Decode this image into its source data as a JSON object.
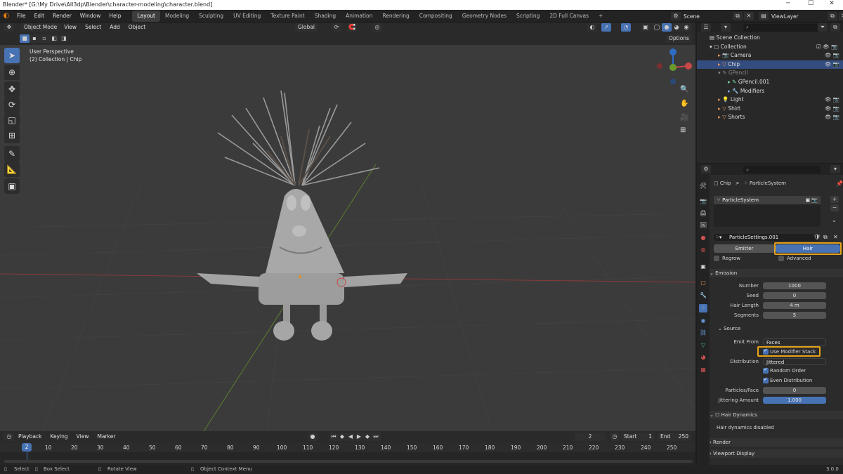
{
  "titlebar": {
    "title": "Blender* [G:\\My Drive\\All3dp\\Blender\\character-modeling\\character.blend]",
    "min": "─",
    "max": "☐",
    "close": "✕"
  },
  "menu": {
    "items": [
      "File",
      "Edit",
      "Render",
      "Window",
      "Help"
    ]
  },
  "workspaces": [
    "Layout",
    "Modeling",
    "Sculpting",
    "UV Editing",
    "Texture Paint",
    "Shading",
    "Animation",
    "Rendering",
    "Compositing",
    "Geometry Nodes",
    "Scripting",
    "2D Full Canvas",
    "+"
  ],
  "scene": {
    "label": "Scene",
    "viewlayer": "ViewLayer"
  },
  "viewport": {
    "mode": "Object Mode",
    "menus": [
      "View",
      "Select",
      "Add",
      "Object"
    ],
    "orientation": "Global",
    "options": "Options",
    "overlay_title": "User Perspective",
    "overlay_sub": "(2) Collection | Chip"
  },
  "outliner": {
    "scene_collection": "Scene Collection",
    "rows": [
      "Collection",
      "Camera",
      "Chip",
      "GPencil",
      "GPencil.001",
      "Modifiers",
      "Light",
      "Shirt",
      "Shorts"
    ]
  },
  "properties": {
    "breadcrumb_obj": "Chip",
    "breadcrumb_sep": ">",
    "breadcrumb_ps": "ParticleSystem",
    "list_item": "ParticleSystem",
    "settings": "ParticleSettings.001",
    "type_emitter": "Emitter",
    "type_hair": "Hair",
    "regrow": "Regrow",
    "advanced": "Advanced",
    "emission": "Emission",
    "number_label": "Number",
    "number": "1000",
    "seed_label": "Seed",
    "seed": "0",
    "hairlen_label": "Hair Length",
    "hairlen": "4 m",
    "segments_label": "Segments",
    "segments": "5",
    "source": "Source",
    "emit_from_label": "Emit From",
    "emit_from": "Faces",
    "use_modifier_stack": "Use Modifier Stack",
    "distribution_label": "Distribution",
    "distribution": "Jittered",
    "random_order": "Random Order",
    "even_distribution": "Even Distribution",
    "ppf_label": "Particles/Face",
    "ppf": "0",
    "jitter_label": "Jittering Amount",
    "jitter": "1.000",
    "hair_dynamics": "Hair Dynamics",
    "hair_dyn_disabled": "Hair dynamics disabled",
    "render": "Render",
    "viewport_display": "Viewport Display"
  },
  "timeline": {
    "menus": [
      "Playback",
      "Keying",
      "View",
      "Marker"
    ],
    "current": "2",
    "start_label": "Start",
    "start": "1",
    "end_label": "End",
    "end": "250",
    "ticks": [
      "2",
      "10",
      "20",
      "30",
      "40",
      "50",
      "60",
      "70",
      "80",
      "90",
      "100",
      "110",
      "120",
      "130",
      "140",
      "150",
      "160",
      "170",
      "180",
      "190",
      "200",
      "210",
      "220",
      "230",
      "240",
      "250"
    ]
  },
  "status": {
    "select": "Select",
    "box": "Box Select",
    "rotate": "Rotate View",
    "ctx": "Object Context Menu",
    "version": "3.0.0"
  }
}
